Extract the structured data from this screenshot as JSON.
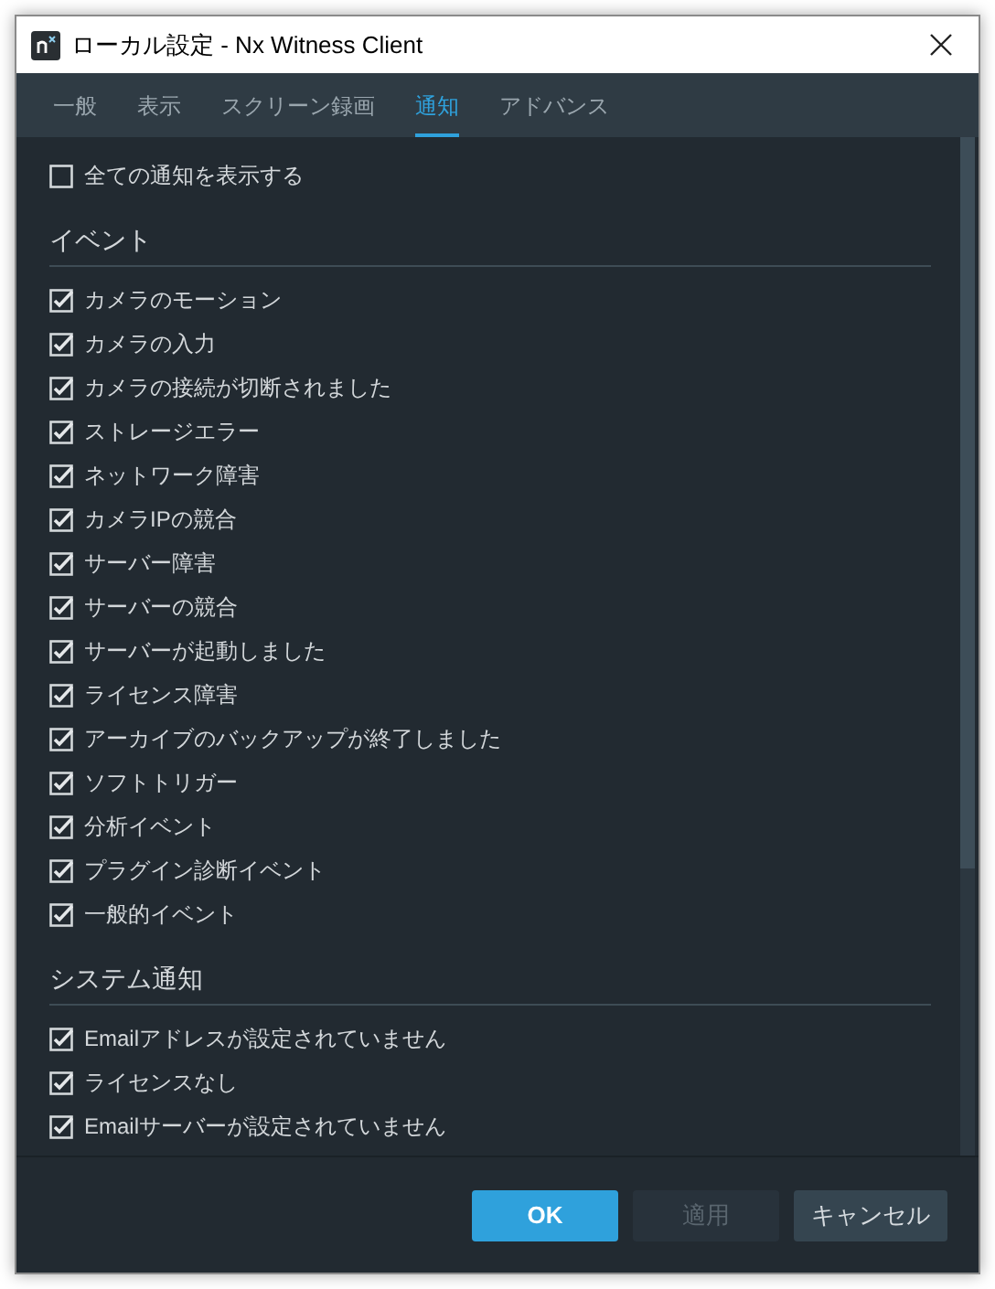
{
  "window": {
    "title": "ローカル設定 - Nx Witness Client"
  },
  "tabs": [
    {
      "label": "一般",
      "selected": false
    },
    {
      "label": "表示",
      "selected": false
    },
    {
      "label": "スクリーン録画",
      "selected": false
    },
    {
      "label": "通知",
      "selected": true
    },
    {
      "label": "アドバンス",
      "selected": false
    }
  ],
  "show_all": {
    "label": "全ての通知を表示する",
    "checked": false
  },
  "sections": [
    {
      "title": "イベント",
      "items": [
        {
          "label": "カメラのモーション",
          "checked": true
        },
        {
          "label": "カメラの入力",
          "checked": true
        },
        {
          "label": "カメラの接続が切断されました",
          "checked": true
        },
        {
          "label": "ストレージエラー",
          "checked": true
        },
        {
          "label": "ネットワーク障害",
          "checked": true
        },
        {
          "label": "カメラIPの競合",
          "checked": true
        },
        {
          "label": "サーバー障害",
          "checked": true
        },
        {
          "label": "サーバーの競合",
          "checked": true
        },
        {
          "label": "サーバーが起動しました",
          "checked": true
        },
        {
          "label": "ライセンス障害",
          "checked": true
        },
        {
          "label": "アーカイブのバックアップが終了しました",
          "checked": true
        },
        {
          "label": "ソフトトリガー",
          "checked": true
        },
        {
          "label": "分析イベント",
          "checked": true
        },
        {
          "label": "プラグイン診断イベント",
          "checked": true
        },
        {
          "label": "一般的イベント",
          "checked": true
        }
      ]
    },
    {
      "title": "システム通知",
      "items": [
        {
          "label": "Emailアドレスが設定されていません",
          "checked": true
        },
        {
          "label": "ライセンスなし",
          "checked": true
        },
        {
          "label": "Emailサーバーが設定されていません",
          "checked": true
        }
      ]
    }
  ],
  "buttons": [
    {
      "label": "OK",
      "kind": "primary",
      "disabled": false
    },
    {
      "label": "適用",
      "kind": "secondary",
      "disabled": true
    },
    {
      "label": "キャンセル",
      "kind": "secondary",
      "disabled": false
    }
  ]
}
